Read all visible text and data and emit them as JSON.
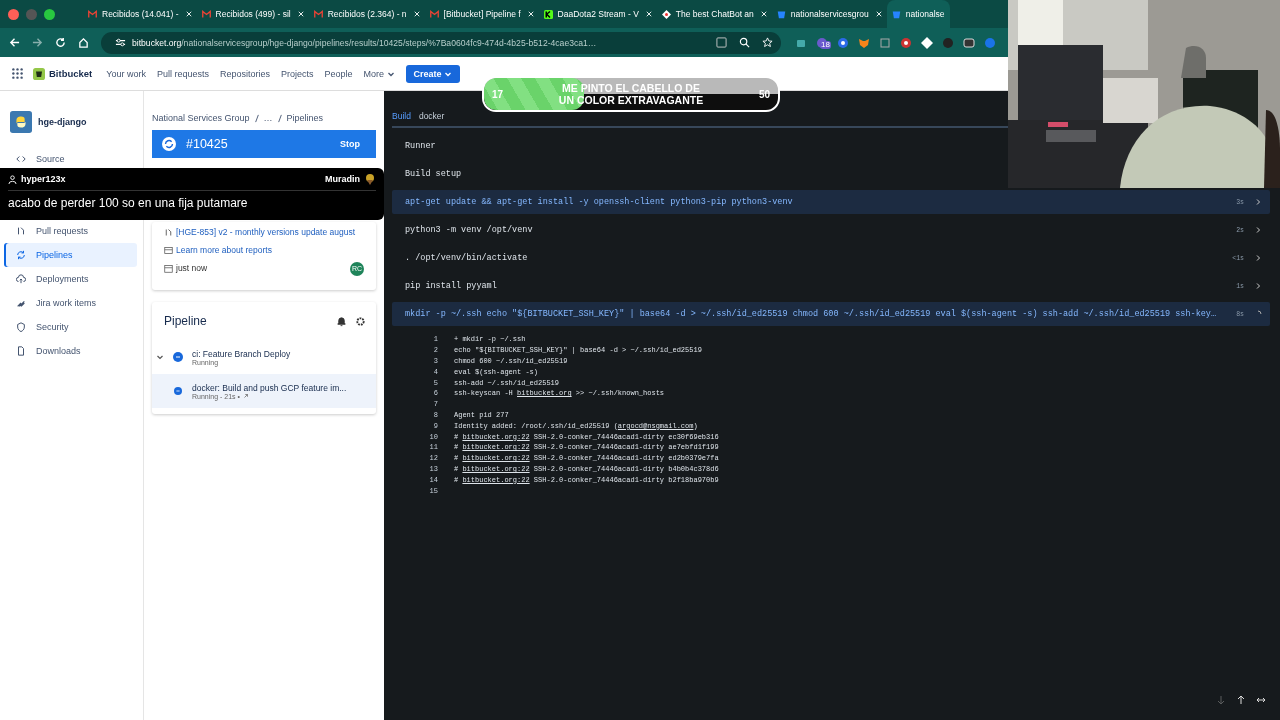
{
  "browser": {
    "tabs": [
      {
        "label": "Recibidos (14.041) -",
        "kind": "mail",
        "selected": false
      },
      {
        "label": "Recibidos (499) - sil",
        "kind": "mail",
        "selected": false
      },
      {
        "label": "Recibidos (2.364) - n",
        "kind": "mail",
        "selected": false
      },
      {
        "label": "[Bitbucket] Pipeline f",
        "kind": "mail",
        "selected": false
      },
      {
        "label": "DaaDota2 Stream - V",
        "kind": "k",
        "selected": false
      },
      {
        "label": "The best ChatBot an",
        "kind": "bot",
        "selected": false
      },
      {
        "label": "nationalservicesgrou",
        "kind": "bb",
        "selected": false
      },
      {
        "label": "nationalse",
        "kind": "bb",
        "selected": true
      }
    ],
    "url_host": "bitbucket.org",
    "url_path": "/nationalservicesgroup/hge-django/pipelines/results/10425/steps/%7Ba0604fc9-474d-4b25-b512-4cae3ca1…",
    "extension_badge": "18"
  },
  "nav": {
    "product": "Bitbucket",
    "items": [
      "Your work",
      "Pull requests",
      "Repositories",
      "Projects",
      "People"
    ],
    "more": "More",
    "create": "Create"
  },
  "sidebar": {
    "repo": "hge-django",
    "items": [
      {
        "label": "Source",
        "kind": "code",
        "selected": false
      },
      {
        "label": "Pull requests",
        "kind": "pr",
        "selected": false
      },
      {
        "label": "Pipelines",
        "kind": "sync",
        "selected": true
      },
      {
        "label": "Deployments",
        "kind": "cloud",
        "selected": false
      },
      {
        "label": "Jira work items",
        "kind": "jira",
        "selected": false
      },
      {
        "label": "Security",
        "kind": "shield",
        "selected": false
      },
      {
        "label": "Downloads",
        "kind": "file",
        "selected": false
      }
    ]
  },
  "breadcrumb": [
    "National Services Group",
    "…",
    "Pipelines"
  ],
  "run": {
    "number": "#10425",
    "action": "Stop"
  },
  "details": {
    "pull_request": "[HGE-853] v2 - monthly versions update august",
    "reports_link": "Learn more about reports",
    "time": "just now",
    "avatar": "RC"
  },
  "pipeline": {
    "title": "Pipeline",
    "steps": [
      {
        "name": "ci: Feature Branch Deploy",
        "status": "Running",
        "kind": "stage",
        "selected": false
      },
      {
        "name": "docker: Build and push GCP feature im...",
        "status": "Running - 21s •",
        "kind": "step",
        "selected": true
      }
    ]
  },
  "log_panel": {
    "tabs": [
      {
        "label": "Build",
        "selected": true
      },
      {
        "label": "docker",
        "selected": false
      }
    ],
    "commands": [
      {
        "text": "Runner",
        "kind": "plain",
        "highlighted": false
      },
      {
        "text": "Build setup",
        "kind": "plain",
        "highlighted": false
      },
      {
        "text": "apt-get update && apt-get install -y openssh-client python3-pip python3-venv",
        "duration": "3s",
        "kind": "done",
        "highlighted": true
      },
      {
        "text": "python3 -m venv /opt/venv",
        "duration": "2s",
        "kind": "done",
        "highlighted": false
      },
      {
        "text": ". /opt/venv/bin/activate",
        "duration": "<1s",
        "kind": "done",
        "highlighted": false
      },
      {
        "text": "pip install pyyaml",
        "duration": "1s",
        "kind": "done",
        "highlighted": false
      },
      {
        "text": "mkdir -p ~/.ssh echo \"${BITBUCKET_SSH_KEY}\" | base64 -d > ~/.ssh/id_ed25519 chmod 600 ~/.ssh/id_ed25519 eval $(ssh-agent -s) ssh-add ~/.ssh/id_ed25519 ssh-key…",
        "duration": "8s",
        "kind": "running",
        "highlighted": true
      }
    ],
    "log": [
      {
        "num": "1",
        "parts": [
          {
            "text": "+ mkdir -p ~/.ssh",
            "link": false
          }
        ]
      },
      {
        "num": "2",
        "parts": [
          {
            "text": "echo \"${BITBUCKET_SSH_KEY}\" | base64 -d > ~/.ssh/id_ed25519",
            "link": false
          }
        ]
      },
      {
        "num": "3",
        "parts": [
          {
            "text": "chmod 600 ~/.ssh/id_ed25519",
            "link": false
          }
        ]
      },
      {
        "num": "4",
        "parts": [
          {
            "text": "eval $(ssh-agent -s)",
            "link": false
          }
        ]
      },
      {
        "num": "5",
        "parts": [
          {
            "text": "ssh-add ~/.ssh/id_ed25519",
            "link": false
          }
        ]
      },
      {
        "num": "6",
        "parts": [
          {
            "text": "ssh-keyscan -H ",
            "link": false
          },
          {
            "text": "bitbucket.org",
            "link": true
          },
          {
            "text": " >> ~/.ssh/known_hosts",
            "link": false
          }
        ]
      },
      {
        "num": "7"
      },
      {
        "num": "8",
        "parts": [
          {
            "text": "Agent pid 277",
            "link": false
          }
        ]
      },
      {
        "num": "9",
        "parts": [
          {
            "text": "Identity added: /root/.ssh/id_ed25519 (",
            "link": false
          },
          {
            "text": "argocd@nsgmail.com",
            "link": true
          },
          {
            "text": ")",
            "link": false
          }
        ]
      },
      {
        "num": "10",
        "parts": [
          {
            "text": "# ",
            "link": false
          },
          {
            "text": "bitbucket.org:22",
            "link": true
          },
          {
            "text": " SSH-2.0-conker_74446acad1-dirty ec30f69eb316",
            "link": false
          }
        ]
      },
      {
        "num": "11",
        "parts": [
          {
            "text": "# ",
            "link": false
          },
          {
            "text": "bitbucket.org:22",
            "link": true
          },
          {
            "text": " SSH-2.0-conker_74446acad1-dirty ae7ebfd1f199",
            "link": false
          }
        ]
      },
      {
        "num": "12",
        "parts": [
          {
            "text": "# ",
            "link": false
          },
          {
            "text": "bitbucket.org:22",
            "link": true
          },
          {
            "text": " SSH-2.0-conker_74446acad1-dirty ed2b0379e7fa",
            "link": false
          }
        ]
      },
      {
        "num": "13",
        "parts": [
          {
            "text": "# ",
            "link": false
          },
          {
            "text": "bitbucket.org:22",
            "link": true
          },
          {
            "text": " SSH-2.0-conker_74446acad1-dirty b4b0b4c378d6",
            "link": false
          }
        ]
      },
      {
        "num": "14",
        "parts": [
          {
            "text": "# ",
            "link": false
          },
          {
            "text": "bitbucket.org:22",
            "link": true
          },
          {
            "text": " SSH-2.0-conker_74446acad1-dirty b2f18ba970b9",
            "link": false
          }
        ]
      },
      {
        "num": "15"
      }
    ]
  },
  "stream_overlay": {
    "goal": {
      "current": "17",
      "text": "ME PINTO EL CABELLO DE UN COLOR EXTRAVAGANTE",
      "target": "50",
      "level": 0.34
    },
    "chat": {
      "user": "hyper123x",
      "badge": "Muradin",
      "message": "acabo de perder 100 so en una fija putamare"
    }
  }
}
